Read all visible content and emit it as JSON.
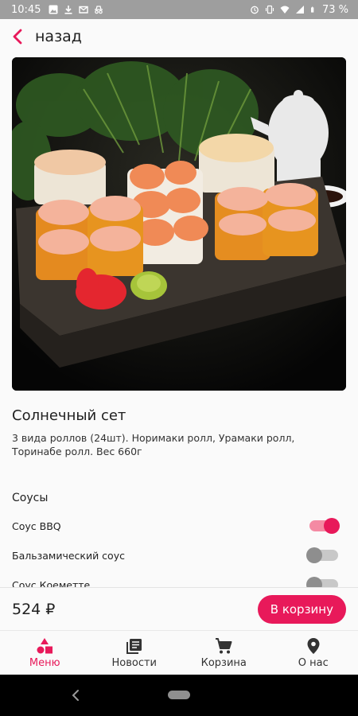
{
  "status_bar": {
    "time": "10:45",
    "battery": "73 %"
  },
  "top_bar": {
    "back_label": "назад"
  },
  "product": {
    "title": "Солнечный сет",
    "description": "3 вида роллов (24шт). Норимаки ролл, Урамаки ролл, Торинабе ролл. Вес 660г"
  },
  "sauces": {
    "header": "Соусы",
    "items": [
      {
        "label": "Соус BBQ",
        "enabled": true
      },
      {
        "label": "Бальзамический соус",
        "enabled": false
      },
      {
        "label": "Соус Коеметте",
        "enabled": false
      }
    ]
  },
  "price_bar": {
    "price": "524 ₽",
    "cart_button": "В корзину"
  },
  "bottom_nav": {
    "items": [
      {
        "label": "Меню",
        "icon": "menu-shapes-icon",
        "active": true
      },
      {
        "label": "Новости",
        "icon": "news-icon",
        "active": false
      },
      {
        "label": "Корзина",
        "icon": "cart-icon",
        "active": false
      },
      {
        "label": "О нас",
        "icon": "location-pin-icon",
        "active": false
      }
    ]
  },
  "colors": {
    "accent": "#e8195a",
    "toggle_on_track": "#f48aa3",
    "status_bar": "#9e9e9e"
  }
}
